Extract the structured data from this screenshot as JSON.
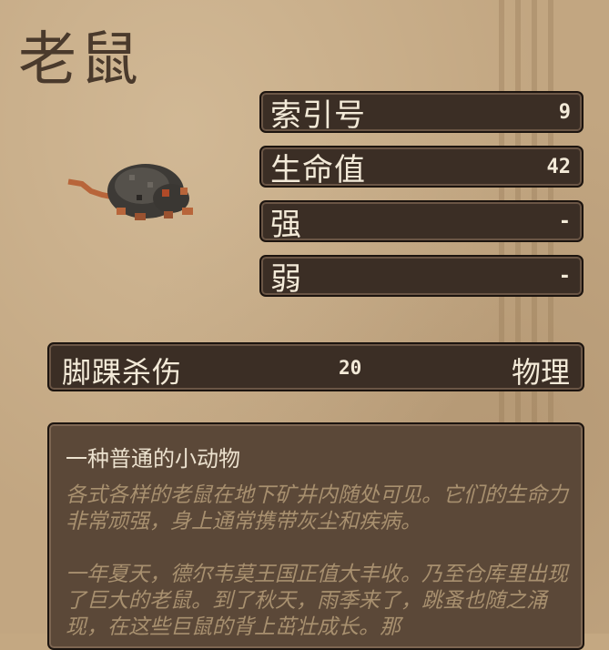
{
  "creature": {
    "name": "老鼠"
  },
  "stats": [
    {
      "label": "索引号",
      "value": "9"
    },
    {
      "label": "生命值",
      "value": "42"
    },
    {
      "label": "强",
      "value": "-"
    },
    {
      "label": "弱",
      "value": "-"
    }
  ],
  "attack": {
    "name": "脚踝杀伤",
    "damage": "20",
    "type": "物理"
  },
  "description": {
    "title": "一种普通的小动物",
    "paragraph1": "各式各样的老鼠在地下矿井内随处可见。它们的生命力非常顽强，身上通常携带灰尘和疾病。",
    "paragraph2": "一年夏天，德尔韦莫王国正值大丰收。乃至仓库里出现了巨大的老鼠。到了秋天，雨季来了，跳蚤也随之涌现，在这些巨鼠的背上茁壮成长。那"
  },
  "colors": {
    "panel": "#3b2e25",
    "parchment": "#c2a681",
    "text_light": "#f3ead8"
  },
  "icons": {
    "creature_sprite": "rat-sprite-icon"
  }
}
